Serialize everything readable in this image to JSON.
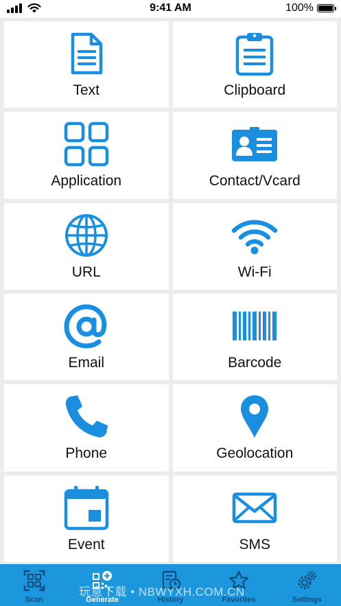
{
  "status_bar": {
    "time": "9:41 AM",
    "battery": "100%"
  },
  "colors": {
    "accent": "#1c97dd",
    "icon_blue": "#1a8fe0",
    "tab_inactive": "#0d4d7a",
    "tile_bg": "#ffffff",
    "page_bg": "#ececec"
  },
  "tiles": [
    {
      "label": "Text",
      "icon": "document-icon"
    },
    {
      "label": "Clipboard",
      "icon": "clipboard-icon"
    },
    {
      "label": "Application",
      "icon": "app-grid-icon"
    },
    {
      "label": "Contact/Vcard",
      "icon": "contact-card-icon"
    },
    {
      "label": "URL",
      "icon": "globe-icon"
    },
    {
      "label": "Wi-Fi",
      "icon": "wifi-icon"
    },
    {
      "label": "Email",
      "icon": "at-sign-icon"
    },
    {
      "label": "Barcode",
      "icon": "barcode-icon"
    },
    {
      "label": "Phone",
      "icon": "phone-icon"
    },
    {
      "label": "Geolocation",
      "icon": "map-pin-icon"
    },
    {
      "label": "Event",
      "icon": "calendar-icon"
    },
    {
      "label": "SMS",
      "icon": "envelope-icon"
    }
  ],
  "tabbar": {
    "tabs": [
      {
        "label": "Scan",
        "icon": "qr-scan-icon",
        "active": false
      },
      {
        "label": "Generate",
        "icon": "qr-add-icon",
        "active": true
      },
      {
        "label": "History",
        "icon": "history-icon",
        "active": false
      },
      {
        "label": "Favorites",
        "icon": "star-icon",
        "active": false
      },
      {
        "label": "Settings",
        "icon": "gear-icon",
        "active": false
      }
    ]
  },
  "watermark": "玩意下载 • NBWYXH.COM.CN"
}
